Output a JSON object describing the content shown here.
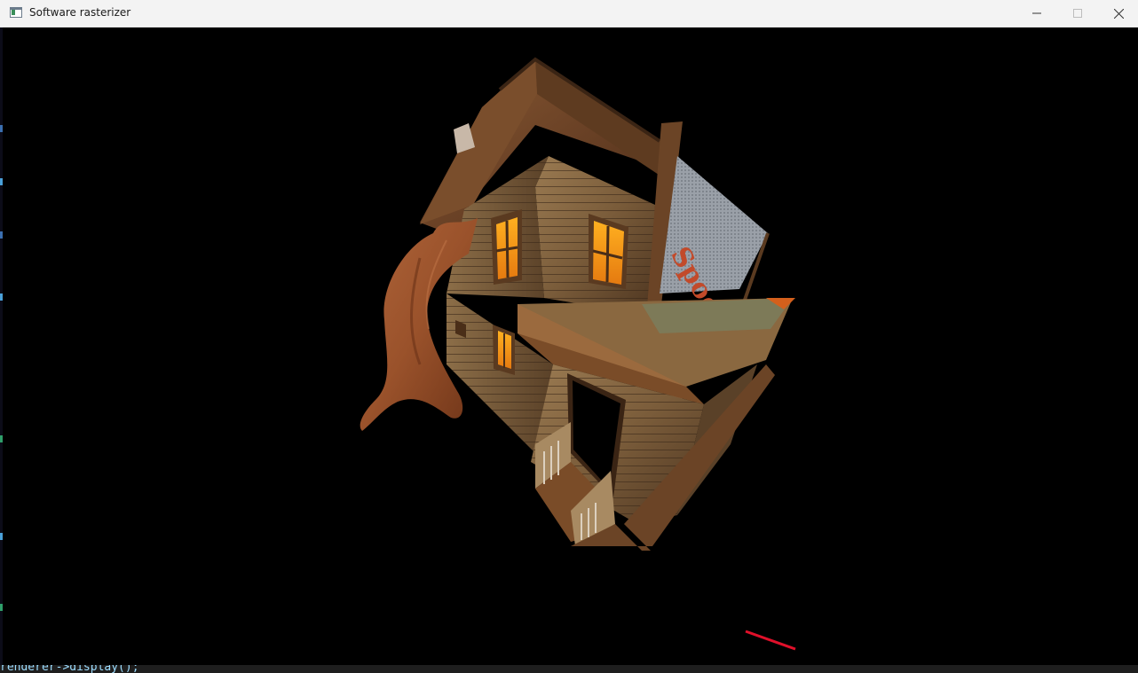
{
  "window": {
    "title": "Software rasterizer",
    "app_icon": "window-app-icon",
    "controls": {
      "minimize_icon": "minimize-icon",
      "maximize_icon": "maximize-icon",
      "close_icon": "close-icon"
    }
  },
  "scene": {
    "description_icon": "render-viewport",
    "background_color": "#000000",
    "sign_text": "Spooky..."
  },
  "background_editor": {
    "code_fragment": "renderer->display();"
  }
}
